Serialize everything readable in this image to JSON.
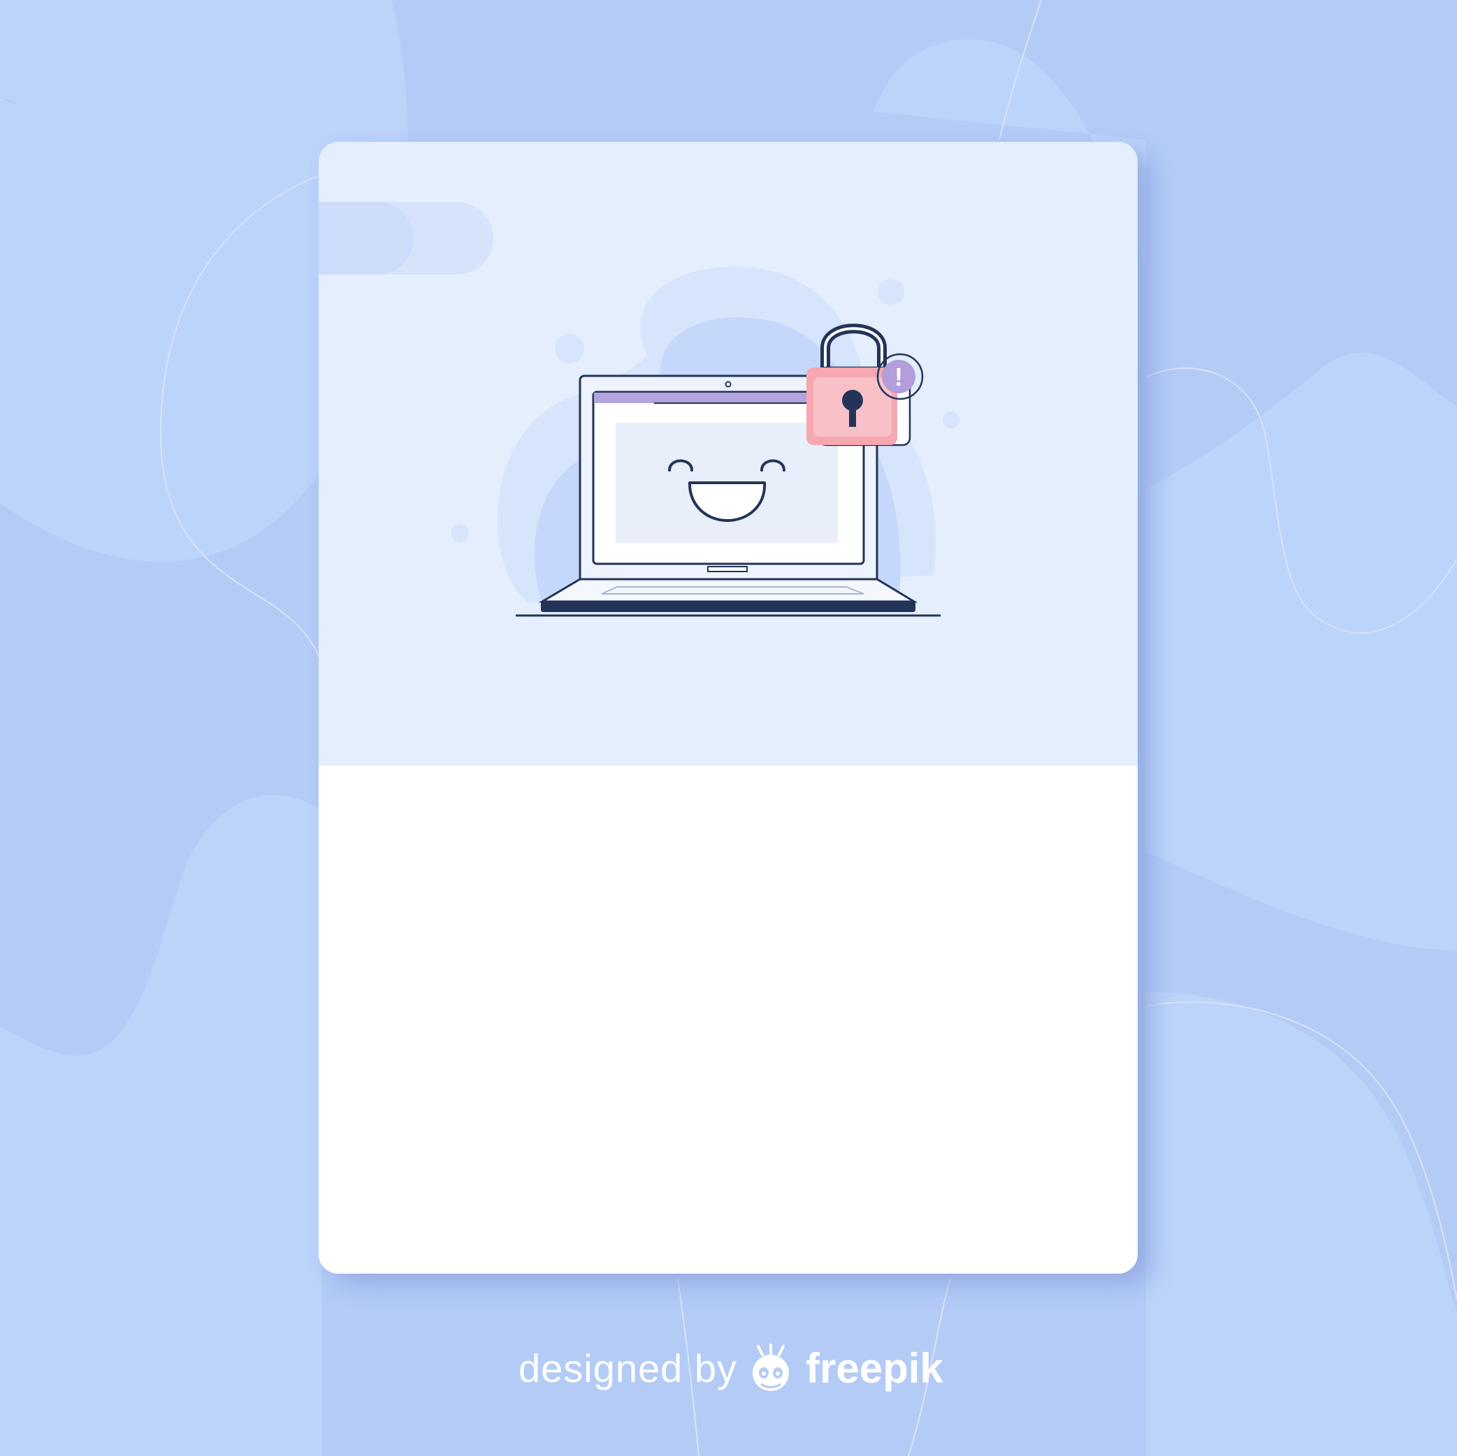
{
  "credit": {
    "prefix": "designed by",
    "brand": "freepik",
    "logo_icon": "freepik-mascot-icon"
  },
  "illustration": {
    "subject": "laptop with smiling face and padlock",
    "lock_badge_symbol": "!"
  },
  "colors": {
    "background": "#b4cbf6",
    "card_top": "#e4eefd",
    "card_body": "#ffffff",
    "outline": "#233458",
    "lock_pink": "#f6a7b0",
    "badge_purple": "#b39ddb"
  }
}
